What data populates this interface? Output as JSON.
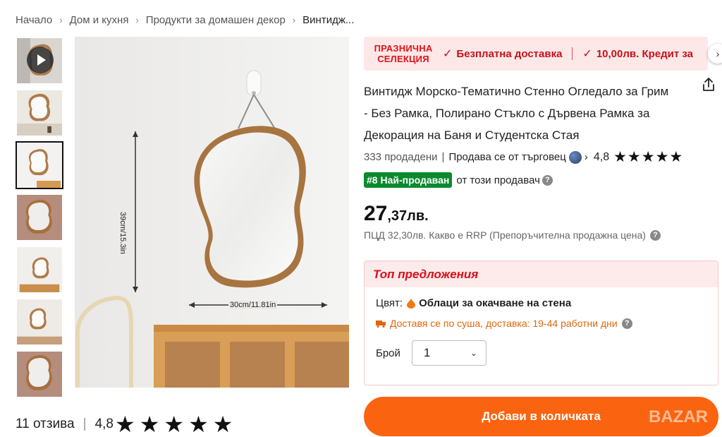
{
  "breadcrumb": {
    "items": [
      "Начало",
      "Дом и кухня",
      "Продукти за домашен декор",
      "Винтидж..."
    ]
  },
  "image_labels": {
    "height": "39cm/15.3in",
    "width": "30cm/11.81in"
  },
  "promo": {
    "badge": "ПРАЗНИЧНА СЕЛЕКЦИЯ",
    "item1": "Безплатна доставка",
    "item2": "10,00лв. Кредит за"
  },
  "product": {
    "title": "Винтидж Морско-Тематично Стенно Огледало за Грим - Без Рамка, Полирано Стъкло с Дървена Рамка за Декорация на Баня и Студентска Стая",
    "sold": "333 продадени",
    "seller": "Продава се от търговец",
    "rating": "4,8",
    "stars": "★★★★★",
    "bestseller_badge": "#8 Най-продаван",
    "bestseller_text": "от този продавач",
    "price_int": "27",
    "price_dec": ",37лв.",
    "price_note": "ПЦД 32,30лв. Какво е RRP (Препоръчителна продажна цена)"
  },
  "offers": {
    "heading": "Топ предложения",
    "color_label": "Цвят:",
    "color_value": "Облаци за окачване на стена",
    "shipping": "Доставя се по суша, доставка: 19-44 работни дни",
    "qty_label": "Брой",
    "qty_value": "1"
  },
  "cart": {
    "button": "Добави в количката"
  },
  "watermark": "BAZAR",
  "reviews": {
    "count": "11 отзива",
    "rating": "4,8",
    "stars": "★★★★★"
  },
  "colors": {
    "accent": "#fa6410",
    "promo_red": "#c4121a",
    "bestseller_green": "#0a8a2d"
  }
}
